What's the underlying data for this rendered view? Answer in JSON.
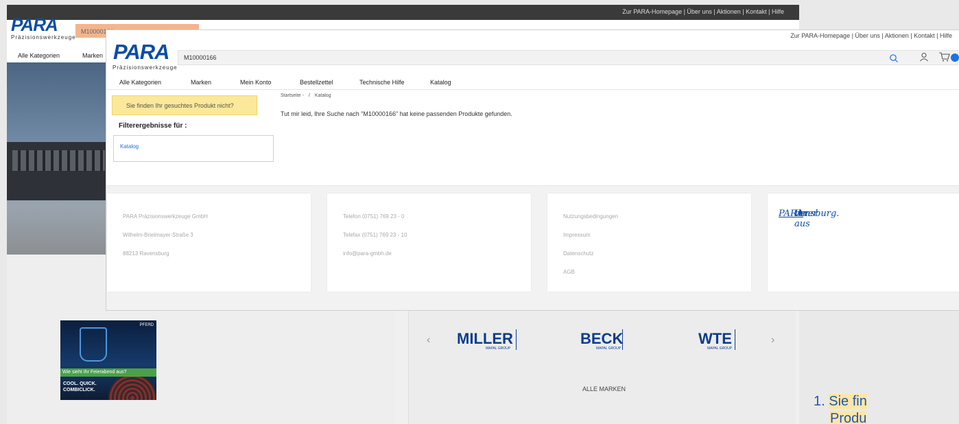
{
  "background_window": {
    "top_links": "Zur PARA-Homepage | Über uns | Aktionen | Kontakt | Hilfe",
    "logo": "PARA",
    "logo_sub": "Präzisionswerkzeuge",
    "search_value": "M10000166",
    "nav": [
      "Alle Kategorien",
      "Marken"
    ],
    "ad": {
      "brand": "PFERD",
      "tagline": "Wie sieht Ihr Feierabend aus?",
      "headline": "COOL. QUICK. COMBICLICK."
    },
    "brands": [
      {
        "name": "MILLER",
        "group": "MAPAL GROUP"
      },
      {
        "name": "BECK",
        "group": "MAPAL GROUP"
      },
      {
        "name": "WTE",
        "group": "MAPAL GROUP"
      }
    ],
    "all_brands_label": "ALLE MARKEN",
    "carousel_prev": "‹",
    "carousel_next": "›"
  },
  "foreground_window": {
    "top_links": "Zur PARA-Homepage | Über uns | Aktionen | Kontakt | Hilfe",
    "logo": "PARA",
    "logo_sub": "Präzisionswerkzeuge",
    "search": {
      "value": "M10000166"
    },
    "icons": {
      "search": "search-icon",
      "user": "user-icon",
      "cart": "cart-icon"
    },
    "nav": [
      "Alle Kategorien",
      "Marken",
      "Mein Konto",
      "Bestellzettel",
      "Technische Hilfe",
      "Katalog"
    ],
    "not_found_button": "Sie finden Ihr gesuchtes Produkt nicht?",
    "breadcrumb": [
      "Startseite -",
      "Katalog"
    ],
    "breadcrumb_sep": "/",
    "no_results_message": "Tut mir leid, Ihre Suche nach \"M10000166\" hat keine passenden Produkte gefunden.",
    "filter_title": "Filterergebnisse für :",
    "filter_items": [
      "Katalog"
    ],
    "footer": {
      "company": [
        "PARA Präzisionswerkzeuge GmbH",
        "Wilhelm-Brielmayer-Straße 3",
        "88213 Ravensburg"
      ],
      "contact": [
        "Telefon (0751) 769 23 - 0",
        "Telefax (0751) 769 23 - 10",
        "info@para-gmbh.de"
      ],
      "legal": [
        "Nutzungsbedingungen",
        "Impressum",
        "Datenschutz",
        "AGB"
      ],
      "slogan_parts": [
        "Ihr ",
        "PA",
        "rtner aus ",
        "RA",
        "vensburg."
      ]
    }
  },
  "slide_note": {
    "number": "1. ",
    "line1": "Sie fin",
    "line2": "Produ"
  }
}
